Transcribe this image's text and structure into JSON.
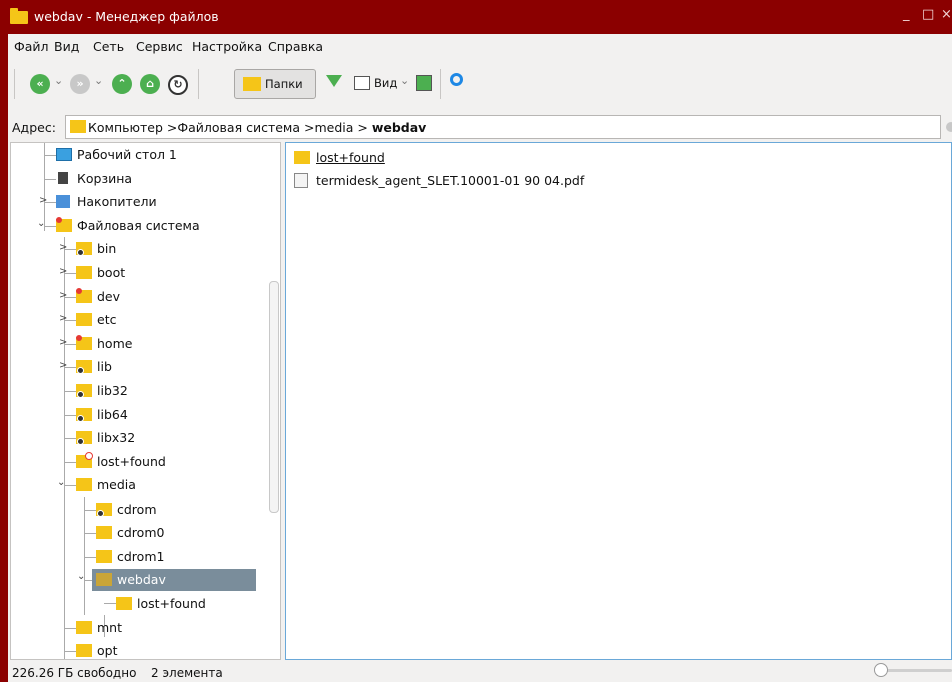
{
  "window": {
    "title": "webdav - Менеджер файлов",
    "controls": [
      "_",
      "□",
      "×"
    ],
    "frame_color": "#8b0000"
  },
  "menu": [
    "Файл",
    "Вид",
    "Сеть",
    "Сервис",
    "Настройка",
    "Справка"
  ],
  "toolbar": {
    "back_icon": "back-icon",
    "forward_icon": "forward-icon",
    "up_icon": "up-icon",
    "home_icon": "home-icon",
    "refresh_icon": "refresh-icon",
    "folders_label": "Папки",
    "filter_icon": "filter-icon",
    "view_label": "Вид",
    "panel_icon": "panel-icon",
    "search_icon": "search-icon",
    "accent": "#4caf50"
  },
  "address": {
    "label": "Адрес:",
    "crumbs": [
      "Компьютер",
      "Файловая система",
      "media",
      "webdav"
    ],
    "sep1": " >",
    "sep2": " >",
    "sep3": " > "
  },
  "tree": {
    "items": [
      {
        "label": "Рабочий стол 1"
      },
      {
        "label": "Корзина"
      },
      {
        "label": "Накопители"
      },
      {
        "label": "Файловая система"
      },
      {
        "label": "bin"
      },
      {
        "label": "boot"
      },
      {
        "label": "dev"
      },
      {
        "label": "etc"
      },
      {
        "label": "home"
      },
      {
        "label": "lib"
      },
      {
        "label": "lib32"
      },
      {
        "label": "lib64"
      },
      {
        "label": "libx32"
      },
      {
        "label": "lost+found"
      },
      {
        "label": "media"
      },
      {
        "label": "cdrom"
      },
      {
        "label": "cdrom0"
      },
      {
        "label": "cdrom1"
      },
      {
        "label": "webdav"
      },
      {
        "label": "lost+found"
      },
      {
        "label": "mnt"
      },
      {
        "label": "opt"
      }
    ],
    "selected_color": "#7a8d9b"
  },
  "files": [
    {
      "name": "lost+found",
      "type": "folder"
    },
    {
      "name": "termidesk_agent_SLET.10001-01 90 04.pdf",
      "type": "pdf"
    }
  ],
  "status": {
    "free": "226.26 ГБ свободно",
    "count": "2 элемента"
  }
}
